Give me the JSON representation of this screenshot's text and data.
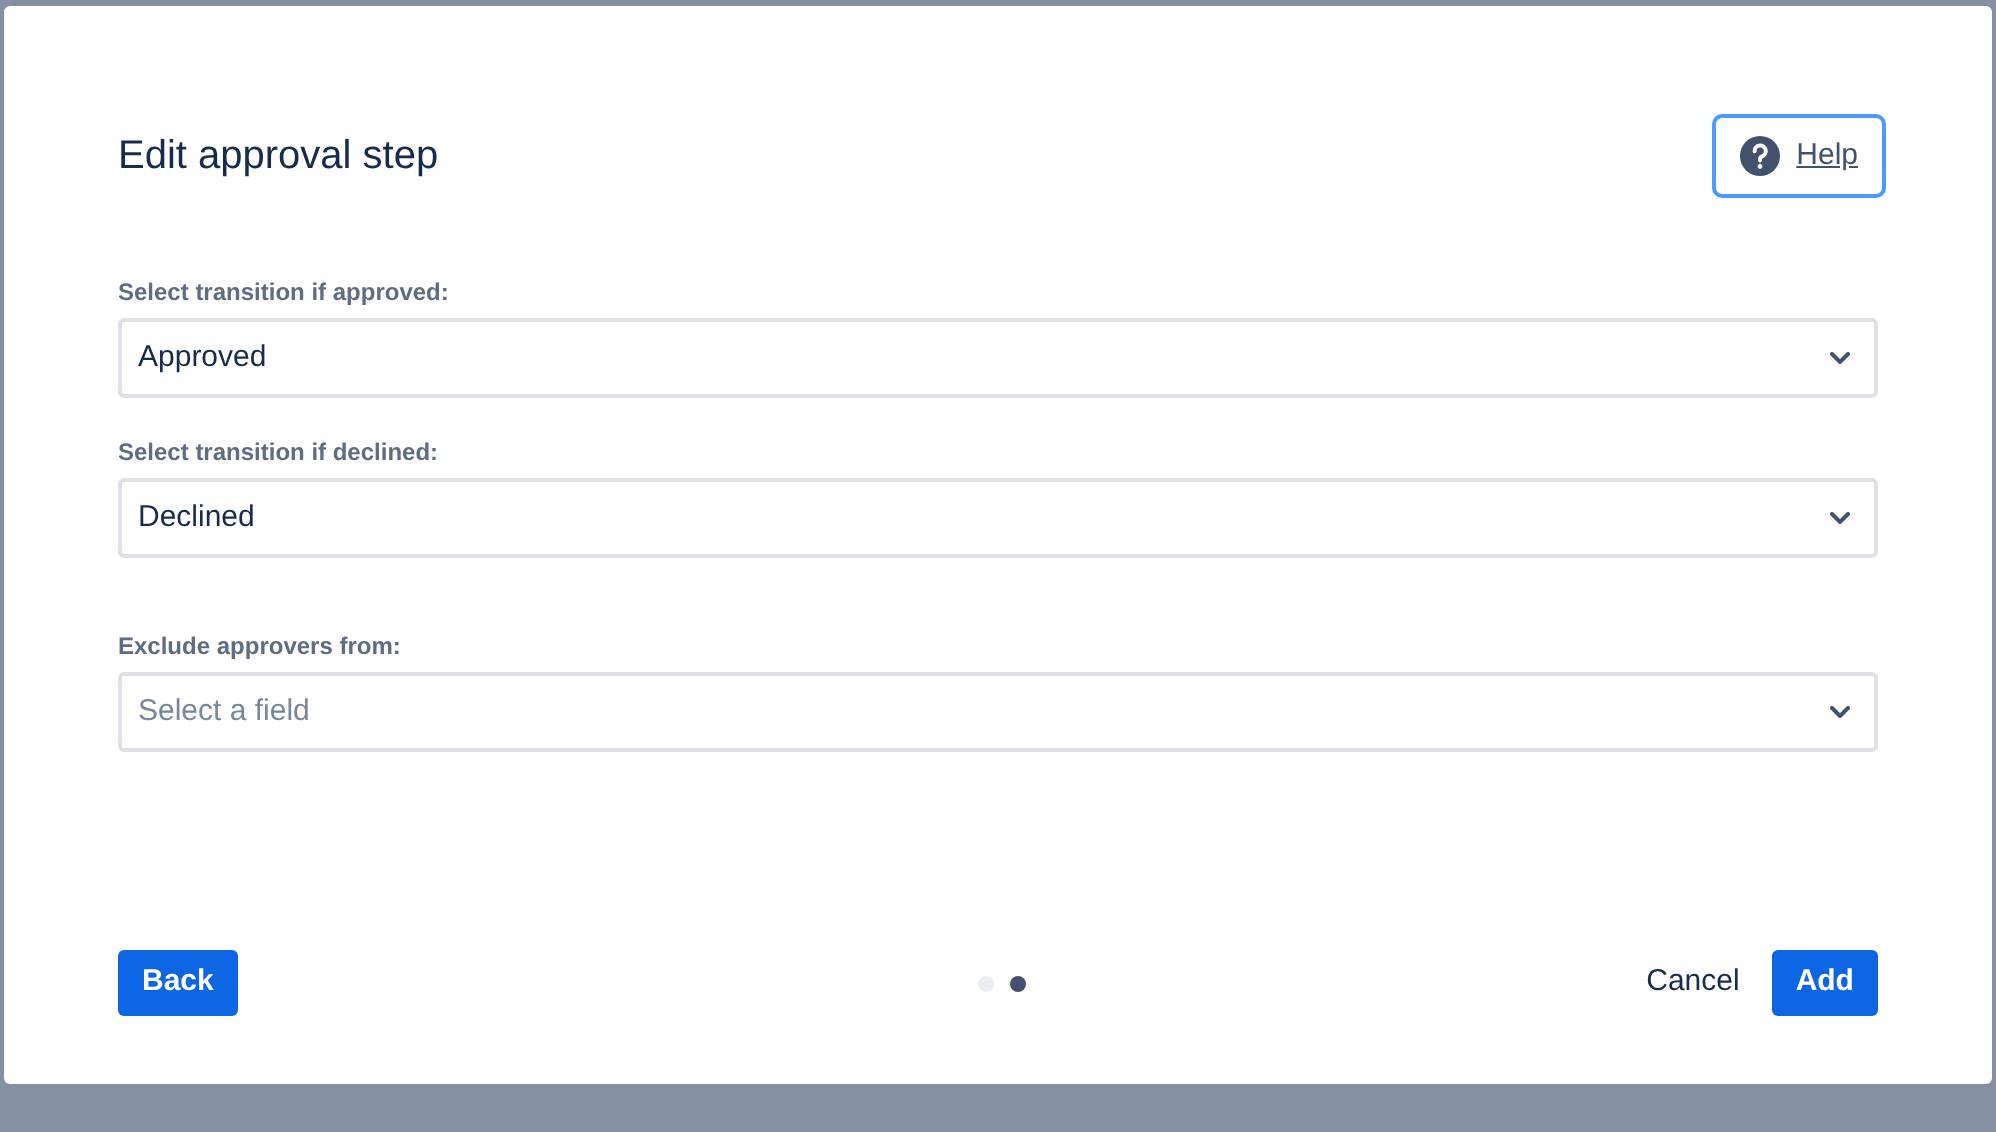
{
  "dialog": {
    "title": "Edit approval step",
    "help": "Help",
    "fields": [
      {
        "label": "Select transition if approved:",
        "value": "Approved"
      },
      {
        "label": "Select transition if declined:",
        "value": "Declined"
      },
      {
        "label": "Exclude approvers from:",
        "placeholder": "Select a field"
      }
    ],
    "back": "Back",
    "pages": [
      {
        "selected": false
      },
      {
        "selected": true
      }
    ],
    "cancel": "Cancel",
    "add": "Add"
  }
}
